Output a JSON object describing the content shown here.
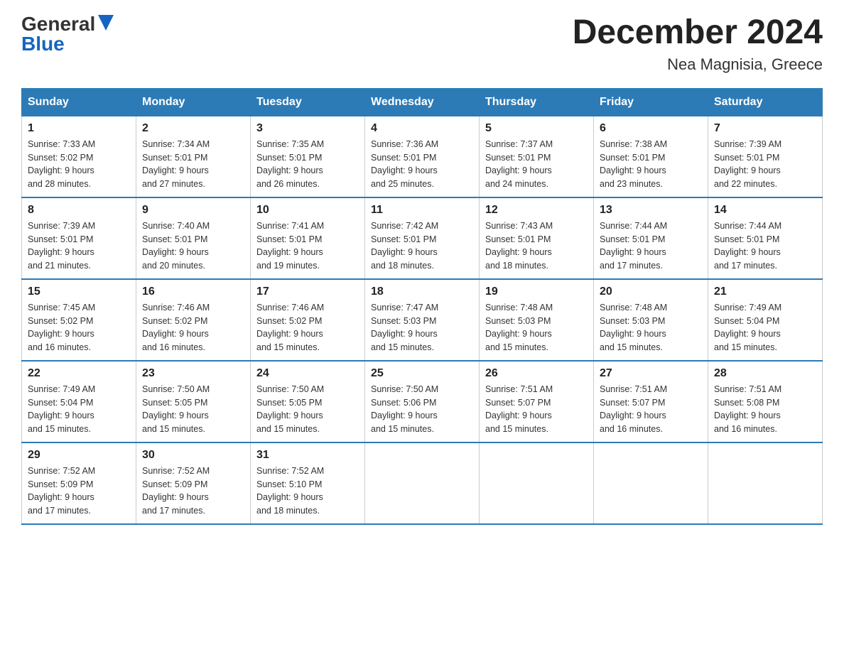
{
  "logo": {
    "general": "General",
    "blue": "Blue"
  },
  "title": "December 2024",
  "subtitle": "Nea Magnisia, Greece",
  "days_of_week": [
    "Sunday",
    "Monday",
    "Tuesday",
    "Wednesday",
    "Thursday",
    "Friday",
    "Saturday"
  ],
  "weeks": [
    [
      {
        "day": "1",
        "sunrise": "7:33 AM",
        "sunset": "5:02 PM",
        "daylight": "9 hours and 28 minutes."
      },
      {
        "day": "2",
        "sunrise": "7:34 AM",
        "sunset": "5:01 PM",
        "daylight": "9 hours and 27 minutes."
      },
      {
        "day": "3",
        "sunrise": "7:35 AM",
        "sunset": "5:01 PM",
        "daylight": "9 hours and 26 minutes."
      },
      {
        "day": "4",
        "sunrise": "7:36 AM",
        "sunset": "5:01 PM",
        "daylight": "9 hours and 25 minutes."
      },
      {
        "day": "5",
        "sunrise": "7:37 AM",
        "sunset": "5:01 PM",
        "daylight": "9 hours and 24 minutes."
      },
      {
        "day": "6",
        "sunrise": "7:38 AM",
        "sunset": "5:01 PM",
        "daylight": "9 hours and 23 minutes."
      },
      {
        "day": "7",
        "sunrise": "7:39 AM",
        "sunset": "5:01 PM",
        "daylight": "9 hours and 22 minutes."
      }
    ],
    [
      {
        "day": "8",
        "sunrise": "7:39 AM",
        "sunset": "5:01 PM",
        "daylight": "9 hours and 21 minutes."
      },
      {
        "day": "9",
        "sunrise": "7:40 AM",
        "sunset": "5:01 PM",
        "daylight": "9 hours and 20 minutes."
      },
      {
        "day": "10",
        "sunrise": "7:41 AM",
        "sunset": "5:01 PM",
        "daylight": "9 hours and 19 minutes."
      },
      {
        "day": "11",
        "sunrise": "7:42 AM",
        "sunset": "5:01 PM",
        "daylight": "9 hours and 18 minutes."
      },
      {
        "day": "12",
        "sunrise": "7:43 AM",
        "sunset": "5:01 PM",
        "daylight": "9 hours and 18 minutes."
      },
      {
        "day": "13",
        "sunrise": "7:44 AM",
        "sunset": "5:01 PM",
        "daylight": "9 hours and 17 minutes."
      },
      {
        "day": "14",
        "sunrise": "7:44 AM",
        "sunset": "5:01 PM",
        "daylight": "9 hours and 17 minutes."
      }
    ],
    [
      {
        "day": "15",
        "sunrise": "7:45 AM",
        "sunset": "5:02 PM",
        "daylight": "9 hours and 16 minutes."
      },
      {
        "day": "16",
        "sunrise": "7:46 AM",
        "sunset": "5:02 PM",
        "daylight": "9 hours and 16 minutes."
      },
      {
        "day": "17",
        "sunrise": "7:46 AM",
        "sunset": "5:02 PM",
        "daylight": "9 hours and 15 minutes."
      },
      {
        "day": "18",
        "sunrise": "7:47 AM",
        "sunset": "5:03 PM",
        "daylight": "9 hours and 15 minutes."
      },
      {
        "day": "19",
        "sunrise": "7:48 AM",
        "sunset": "5:03 PM",
        "daylight": "9 hours and 15 minutes."
      },
      {
        "day": "20",
        "sunrise": "7:48 AM",
        "sunset": "5:03 PM",
        "daylight": "9 hours and 15 minutes."
      },
      {
        "day": "21",
        "sunrise": "7:49 AM",
        "sunset": "5:04 PM",
        "daylight": "9 hours and 15 minutes."
      }
    ],
    [
      {
        "day": "22",
        "sunrise": "7:49 AM",
        "sunset": "5:04 PM",
        "daylight": "9 hours and 15 minutes."
      },
      {
        "day": "23",
        "sunrise": "7:50 AM",
        "sunset": "5:05 PM",
        "daylight": "9 hours and 15 minutes."
      },
      {
        "day": "24",
        "sunrise": "7:50 AM",
        "sunset": "5:05 PM",
        "daylight": "9 hours and 15 minutes."
      },
      {
        "day": "25",
        "sunrise": "7:50 AM",
        "sunset": "5:06 PM",
        "daylight": "9 hours and 15 minutes."
      },
      {
        "day": "26",
        "sunrise": "7:51 AM",
        "sunset": "5:07 PM",
        "daylight": "9 hours and 15 minutes."
      },
      {
        "day": "27",
        "sunrise": "7:51 AM",
        "sunset": "5:07 PM",
        "daylight": "9 hours and 16 minutes."
      },
      {
        "day": "28",
        "sunrise": "7:51 AM",
        "sunset": "5:08 PM",
        "daylight": "9 hours and 16 minutes."
      }
    ],
    [
      {
        "day": "29",
        "sunrise": "7:52 AM",
        "sunset": "5:09 PM",
        "daylight": "9 hours and 17 minutes."
      },
      {
        "day": "30",
        "sunrise": "7:52 AM",
        "sunset": "5:09 PM",
        "daylight": "9 hours and 17 minutes."
      },
      {
        "day": "31",
        "sunrise": "7:52 AM",
        "sunset": "5:10 PM",
        "daylight": "9 hours and 18 minutes."
      },
      null,
      null,
      null,
      null
    ]
  ]
}
